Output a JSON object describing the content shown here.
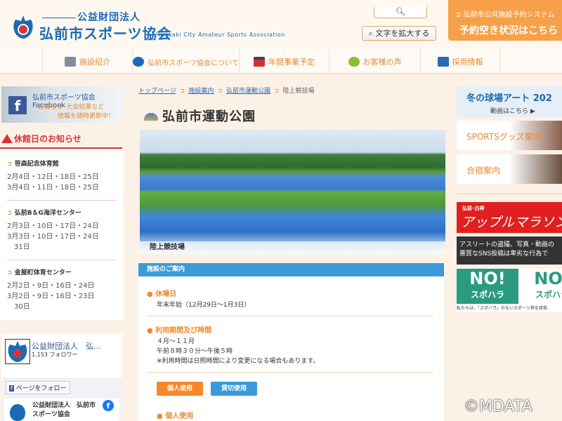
{
  "header": {
    "org_type": "公益財団法人",
    "org_name": "弘前市スポーツ協会",
    "org_name_en": "Hirosaki City Amateur Sports Association",
    "search_icon": "search-icon",
    "zoom_button": "文字を拡大する",
    "reserve_line1": "弘前市公共施設予約システム",
    "reserve_line2": "予約空き状況はこちら"
  },
  "nav": [
    {
      "label": "施設紹介"
    },
    {
      "label": "弘前市スポーツ協会について"
    },
    {
      "label": "年間事業予定"
    },
    {
      "label": "お客様の声"
    },
    {
      "label": "採用情報"
    }
  ],
  "sidebar": {
    "fb_banner": {
      "title": "弘前市スポーツ協会 Facebook",
      "line1": "お知らせ･大会結果など",
      "line2": "情報を随時更新中！"
    },
    "closed_title": "休館日のお知らせ",
    "facilities": [
      {
        "name": "笹森記念体育館",
        "dates": [
          "2月4日・12日・18日・25日",
          "3月4日・11日・18日・25日"
        ]
      },
      {
        "name": "弘前B＆G海洋センター",
        "dates": [
          "2月3日・10日・17日・24日",
          "3月3日・10日・17日・24日",
          "　31日"
        ]
      },
      {
        "name": "金屋町体育センター",
        "dates": [
          "2月2日・9日・16日・24日",
          "3月2日・9日・16日・23日",
          "　30日"
        ]
      }
    ],
    "fb_widget": {
      "name": "公益財団法人　弘...",
      "followers": "1,153 フォロワー",
      "follow_button": "ページをフォロー",
      "card_name_1": "公益財団法人　弘前市",
      "card_name_2": "スポーツ協会"
    }
  },
  "main": {
    "breadcrumb": [
      "トップページ",
      "施設案内",
      "弘前市運動公園",
      "陸上競技場"
    ],
    "title": "弘前市運動公園",
    "photo_caption": "陸上競技場",
    "section_title": "施設のご案内",
    "closed_label": "休場日",
    "closed_text": "年末年始（12月29日～1月3日）",
    "hours_label": "利用期間及び時間",
    "hours_lines": [
      "４月～１１月",
      "午前８時３０分～午後５時",
      "※利用時間は日照時間により変更になる場合もあります。"
    ],
    "btn_personal": "個人使用",
    "btn_charter": "貸切使用",
    "personal_heading": "個人使用"
  },
  "right": {
    "winter_art": "冬の球場アート 202",
    "winter_sub": "動画はこちら",
    "sports_goods": "SPORTSグッズ案内",
    "camp": "合宿案内",
    "marathon_small": "弘前･白神",
    "marathon": "アップルマラソン",
    "sns_1": "アスリートの盗撮、写真・動画の",
    "sns_2": "悪質なSNS投稿は卑劣な行為で",
    "no_label": "NO!",
    "supohara": "スポハラ",
    "supohara_note": "私たちは、「スポハラ」のないスポーツ界を目指"
  },
  "watermark": "©MDATA",
  "colors": {
    "brand_blue": "#1a6bb5",
    "accent_orange": "#f7a04a",
    "section_blue": "#3b9ad9",
    "alert_red": "#d9333a"
  }
}
